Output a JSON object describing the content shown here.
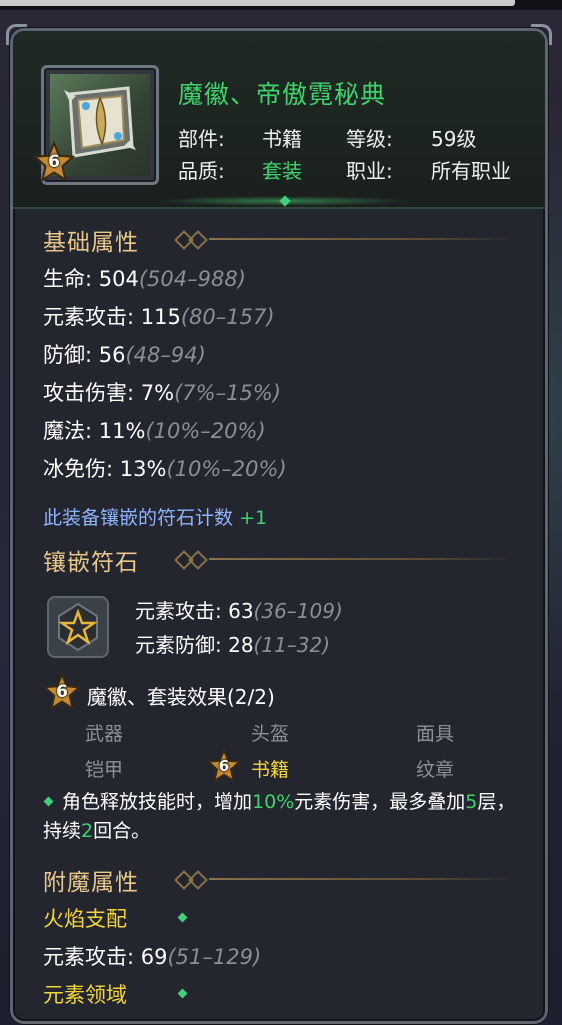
{
  "item": {
    "name": "魔徽、帝傲霓秘典",
    "star_level": "6",
    "part_label": "部件:",
    "part_value": "书籍",
    "level_label": "等级:",
    "level_value": "59级",
    "quality_label": "品质:",
    "quality_value": "套装",
    "class_label": "职业:",
    "class_value": "所有职业"
  },
  "base_attributes": {
    "title": "基础属性",
    "stats": [
      {
        "label": "生命: 504",
        "range": "(504–988)"
      },
      {
        "label": "元素攻击: 115",
        "range": "(80–157)"
      },
      {
        "label": "防御: 56",
        "range": "(48–94)"
      },
      {
        "label": "攻击伤害: 7%",
        "range": "(7%–15%)"
      },
      {
        "label": "魔法: 11%",
        "range": "(10%–20%)"
      },
      {
        "label": "冰免伤: 13%",
        "range": "(10%–20%)"
      }
    ],
    "rune_count_note": "此装备镶嵌的符石计数",
    "rune_count_plus": "+1"
  },
  "runes": {
    "title": "镶嵌符石",
    "stats": [
      {
        "label": "元素攻击: 63",
        "range": "(36–109)"
      },
      {
        "label": "元素防御: 28",
        "range": "(11–32)"
      }
    ]
  },
  "set_bonus": {
    "star": "6",
    "title": "魔徽、套装效果(2/2)",
    "pieces": [
      {
        "name": "武器",
        "active": false
      },
      {
        "name": "头盔",
        "active": false
      },
      {
        "name": "面具",
        "active": false
      },
      {
        "name": "铠甲",
        "active": false
      },
      {
        "name": "书籍",
        "active": true,
        "star": "6"
      },
      {
        "name": "纹章",
        "active": false
      }
    ],
    "effect_part1": "角色释放技能时，增加",
    "effect_hl1": "10%",
    "effect_part2": "元素伤害，最多叠加",
    "effect_hl2": "5",
    "effect_part3": "层，持续",
    "effect_hl3": "2",
    "effect_part4": "回合。"
  },
  "enchant": {
    "title": "附魔属性",
    "entries": [
      {
        "name": "火焰支配",
        "stat": "元素攻击: 69",
        "range": "(51–129)"
      },
      {
        "name": "元素领域"
      }
    ]
  },
  "colors": {
    "name_green": "#3fd46b",
    "section_gold": "#e9c88a",
    "range_gray": "#8b8e98",
    "note_blue": "#8fb4ff",
    "active_yellow": "#f4d63a"
  }
}
